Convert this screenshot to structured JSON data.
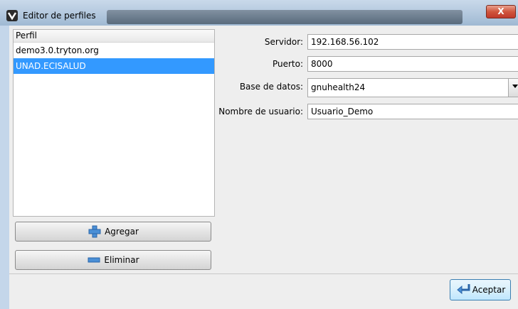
{
  "window": {
    "title": "Editor de perfiles",
    "close_label": "X"
  },
  "profiles": {
    "header": "Perfil",
    "items": [
      {
        "label": "demo3.0.tryton.org",
        "selected": false
      },
      {
        "label": "UNAD.ECISALUD",
        "selected": true
      }
    ],
    "add_label": "Agregar",
    "remove_label": "Eliminar"
  },
  "form": {
    "server_label": "Servidor:",
    "server_value": "192.168.56.102",
    "port_label": "Puerto:",
    "port_value": "8000",
    "database_label": "Base de datos:",
    "database_value": "gnuhealth24",
    "username_label": "Nombre de usuario:",
    "username_value": "Usuario_Demo"
  },
  "footer": {
    "accept_label": "Aceptar"
  },
  "colors": {
    "selection": "#3399ff",
    "close": "#c0392b",
    "accent": "#3c7fb1"
  },
  "icons": [
    "app-icon",
    "close-icon",
    "plus-icon",
    "minus-icon",
    "accept-icon",
    "dropdown-arrow-icon"
  ]
}
